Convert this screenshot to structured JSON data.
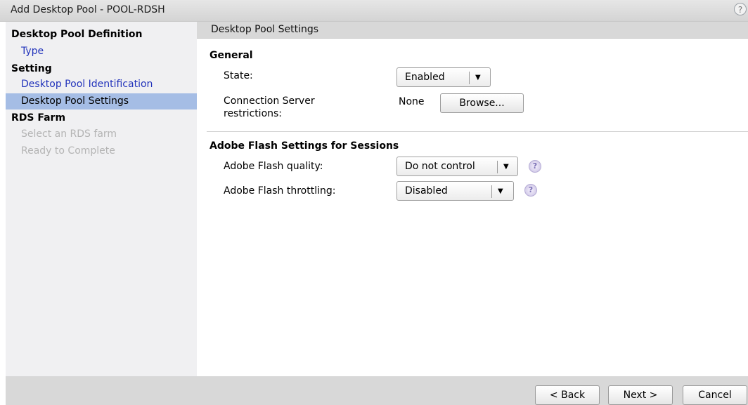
{
  "window": {
    "title": "Add Desktop Pool - POOL-RDSH",
    "help_glyph": "?"
  },
  "nav": {
    "items": [
      {
        "label": "Desktop Pool Definition",
        "kind": "group"
      },
      {
        "label": "Type",
        "kind": "link"
      },
      {
        "label": "Setting",
        "kind": "group"
      },
      {
        "label": "Desktop Pool Identification",
        "kind": "link"
      },
      {
        "label": "Desktop Pool Settings",
        "kind": "selected"
      },
      {
        "label": "RDS Farm",
        "kind": "group"
      },
      {
        "label": "Select an RDS farm",
        "kind": "disabled"
      },
      {
        "label": "Ready to Complete",
        "kind": "disabled"
      }
    ]
  },
  "section": {
    "title": "Desktop Pool Settings"
  },
  "general": {
    "heading": "General",
    "state_label": "State:",
    "state_value": "Enabled",
    "conn_label_line1": "Connection Server",
    "conn_label_line2": "restrictions:",
    "conn_value": "None",
    "browse_label": "Browse..."
  },
  "flash": {
    "heading": "Adobe Flash Settings for Sessions",
    "quality_label": "Adobe Flash quality:",
    "quality_value": "Do not control",
    "throttling_label": "Adobe Flash throttling:",
    "throttling_value": "Disabled",
    "help_glyph": "?"
  },
  "footer": {
    "back_label": "< Back",
    "next_label": "Next >",
    "cancel_label": "Cancel"
  },
  "colors": {
    "selected_bg": "#a5bde5",
    "link": "#2233bb",
    "disabled": "#b4b4b4"
  }
}
